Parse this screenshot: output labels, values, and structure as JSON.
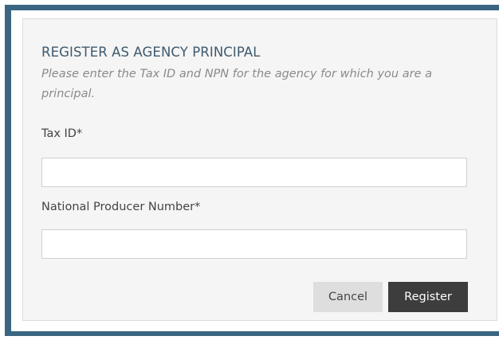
{
  "dialog": {
    "title": "REGISTER AS AGENCY PRINCIPAL",
    "instructions": "Please enter the Tax ID and NPN for the agency for which you are a principal.",
    "fields": {
      "tax_id": {
        "label": "Tax ID*",
        "value": "",
        "placeholder": ""
      },
      "npn": {
        "label": "National Producer Number*",
        "value": "",
        "placeholder": ""
      }
    },
    "buttons": {
      "cancel_label": "Cancel",
      "register_label": "Register"
    }
  },
  "colors": {
    "frame_border": "#3b6681",
    "panel_background": "#f5f5f5",
    "title_text": "#3e5a6e",
    "instruction_text": "#8a8a8a",
    "cancel_button": "#dedede",
    "register_button": "#3d3d3d"
  }
}
